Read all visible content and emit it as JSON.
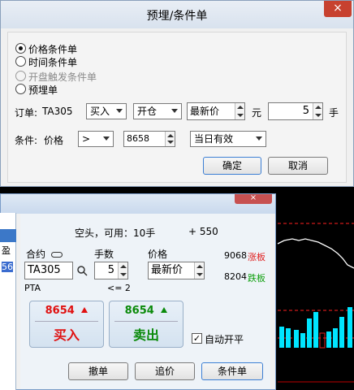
{
  "dialog": {
    "title": "预埋/条件单",
    "close_icon": "×",
    "order_types": [
      {
        "label": "价格条件单",
        "selected": true,
        "enabled": true
      },
      {
        "label": "时间条件单",
        "selected": false,
        "enabled": true
      },
      {
        "label": "开盘触发条件单",
        "selected": false,
        "enabled": false
      },
      {
        "label": "预埋单",
        "selected": false,
        "enabled": true
      }
    ],
    "order_label": "订单:",
    "contract": "TA305",
    "direction": "买入",
    "offset": "开仓",
    "price_type": "最新价",
    "price_unit": "元",
    "quantity": "5",
    "quantity_unit": "手",
    "condition_label": "条件:",
    "condition_field": "价格",
    "comparator": ">",
    "trigger_price": "8658",
    "validity": "当日有效",
    "ok_label": "确定",
    "cancel_label": "取消"
  },
  "order_panel": {
    "close_icon": "×",
    "position_summary": "空头，可用：10手",
    "position_pnl": "+ 550",
    "contract_label": "合约",
    "quantity_label": "手数",
    "price_label": "价格",
    "contract_value": "TA305",
    "quantity_value": "5",
    "price_value": "最新价",
    "product_name": "PTA",
    "quantity_hint": "<= 2",
    "limit_up_price": "9068",
    "limit_up_label": "涨板",
    "limit_down_price": "8204",
    "limit_down_label": "跌板",
    "buy_price": "8654",
    "buy_label": "买入",
    "sell_price": "8654",
    "sell_label": "卖出",
    "auto_open_close_label": "自动开平",
    "auto_open_close_checked": true,
    "withdraw_label": "撤单",
    "chase_label": "追价",
    "conditional_label": "条件单",
    "side_list_header": "",
    "side_list_items": [
      "盈",
      "56"
    ]
  },
  "colors": {
    "buy_red": "#e01010",
    "sell_green": "#0a8a0a",
    "limit_up_red": "#e02020",
    "limit_down_green": "#10a010",
    "chart_line": "#ffffff",
    "chart_bars": "#00e5ff",
    "chart_dashed": "#ff2020"
  }
}
